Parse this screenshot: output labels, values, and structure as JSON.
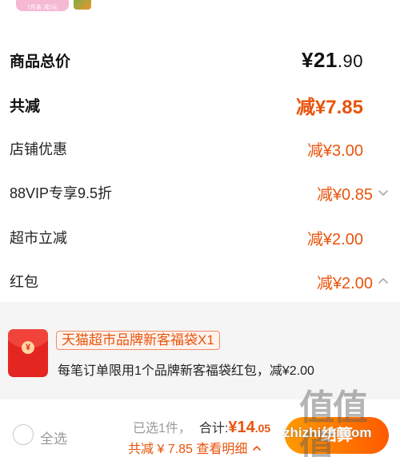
{
  "promo": {
    "badge_text": "1件装 减2元"
  },
  "summary": {
    "goods_total_label": "商品总价",
    "goods_total_int": "¥21",
    "goods_total_dec": ".90",
    "total_discount_label": "共减",
    "total_discount_value": "减¥7.85",
    "rows": [
      {
        "label": "店铺优惠",
        "value": "减¥3.00"
      },
      {
        "label": "88VIP专享9.5折",
        "value": "减¥0.85"
      },
      {
        "label": "超市立减",
        "value": "减¥2.00"
      },
      {
        "label": "红包",
        "value": "减¥2.00"
      }
    ]
  },
  "red_packet": {
    "coin_glyph": "¥",
    "tag": "天猫超市品牌新客福袋X1",
    "description": "每笔订单限用1个品牌新客福袋红包，减¥2.00"
  },
  "bottom_bar": {
    "select_all": "全选",
    "selected_count": "已选1件，",
    "total_label": "合计:",
    "total_int": "¥14",
    "total_dec": ".05",
    "discount_line": "共减 ¥ 7.85  查看明细",
    "checkout_label": "结算"
  },
  "watermark": {
    "logo": "值值值",
    "url": "zhizhizhi.com"
  },
  "colors": {
    "accent": "#e8540c",
    "packet_red": "#e3261f",
    "panel_bg": "#f5f5f5"
  },
  "icons": {
    "collapse": "chevron-down-icon",
    "expand": "chevron-up-icon"
  }
}
